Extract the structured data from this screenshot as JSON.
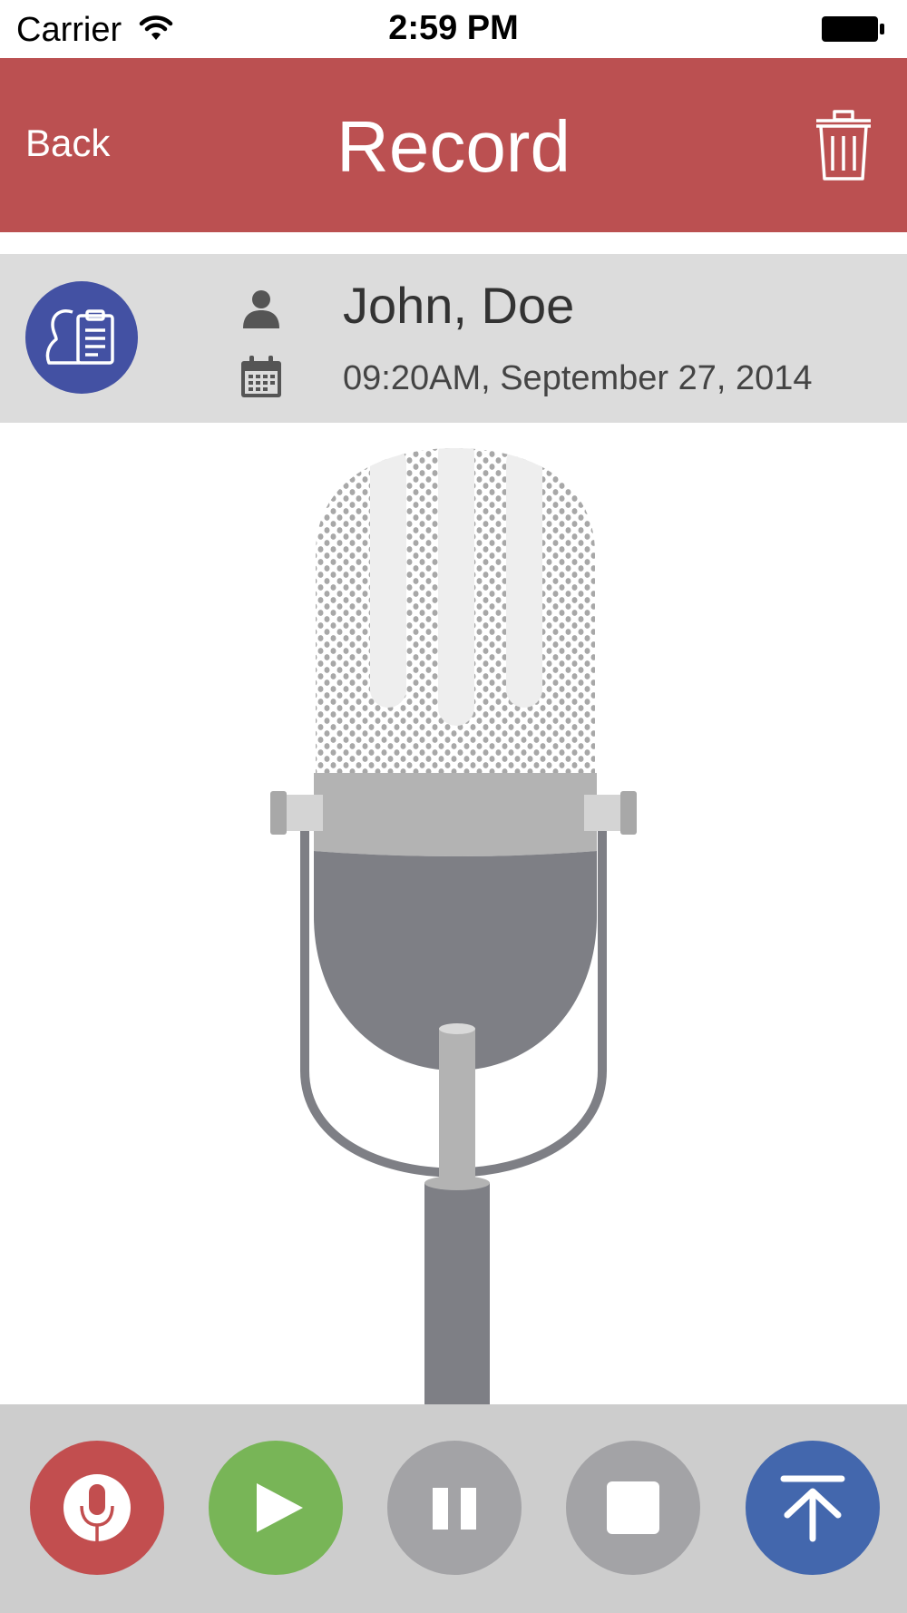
{
  "status_bar": {
    "carrier": "Carrier",
    "time": "2:59 PM",
    "icons": [
      "wifi-icon",
      "battery-icon"
    ]
  },
  "nav": {
    "back_label": "Back",
    "title": "Record",
    "trash_icon": "trash-icon",
    "background_color": "#bb5051"
  },
  "info": {
    "notes_icon": "patient-notes-icon",
    "person_icon": "person-icon",
    "calendar_icon": "calendar-icon",
    "patient_name": "John, Doe",
    "appointment_time": "09:20AM, September 27, 2014"
  },
  "illustration": {
    "icon": "microphone-illustration"
  },
  "controls": [
    {
      "name": "record",
      "icon": "microphone-icon",
      "color": "#c24e4f"
    },
    {
      "name": "play",
      "icon": "play-icon",
      "color": "#78b557"
    },
    {
      "name": "pause",
      "icon": "pause-icon",
      "color": "#a3a3a6"
    },
    {
      "name": "stop",
      "icon": "stop-icon",
      "color": "#a3a3a6"
    },
    {
      "name": "upload",
      "icon": "upload-icon",
      "color": "#4367ad"
    }
  ]
}
